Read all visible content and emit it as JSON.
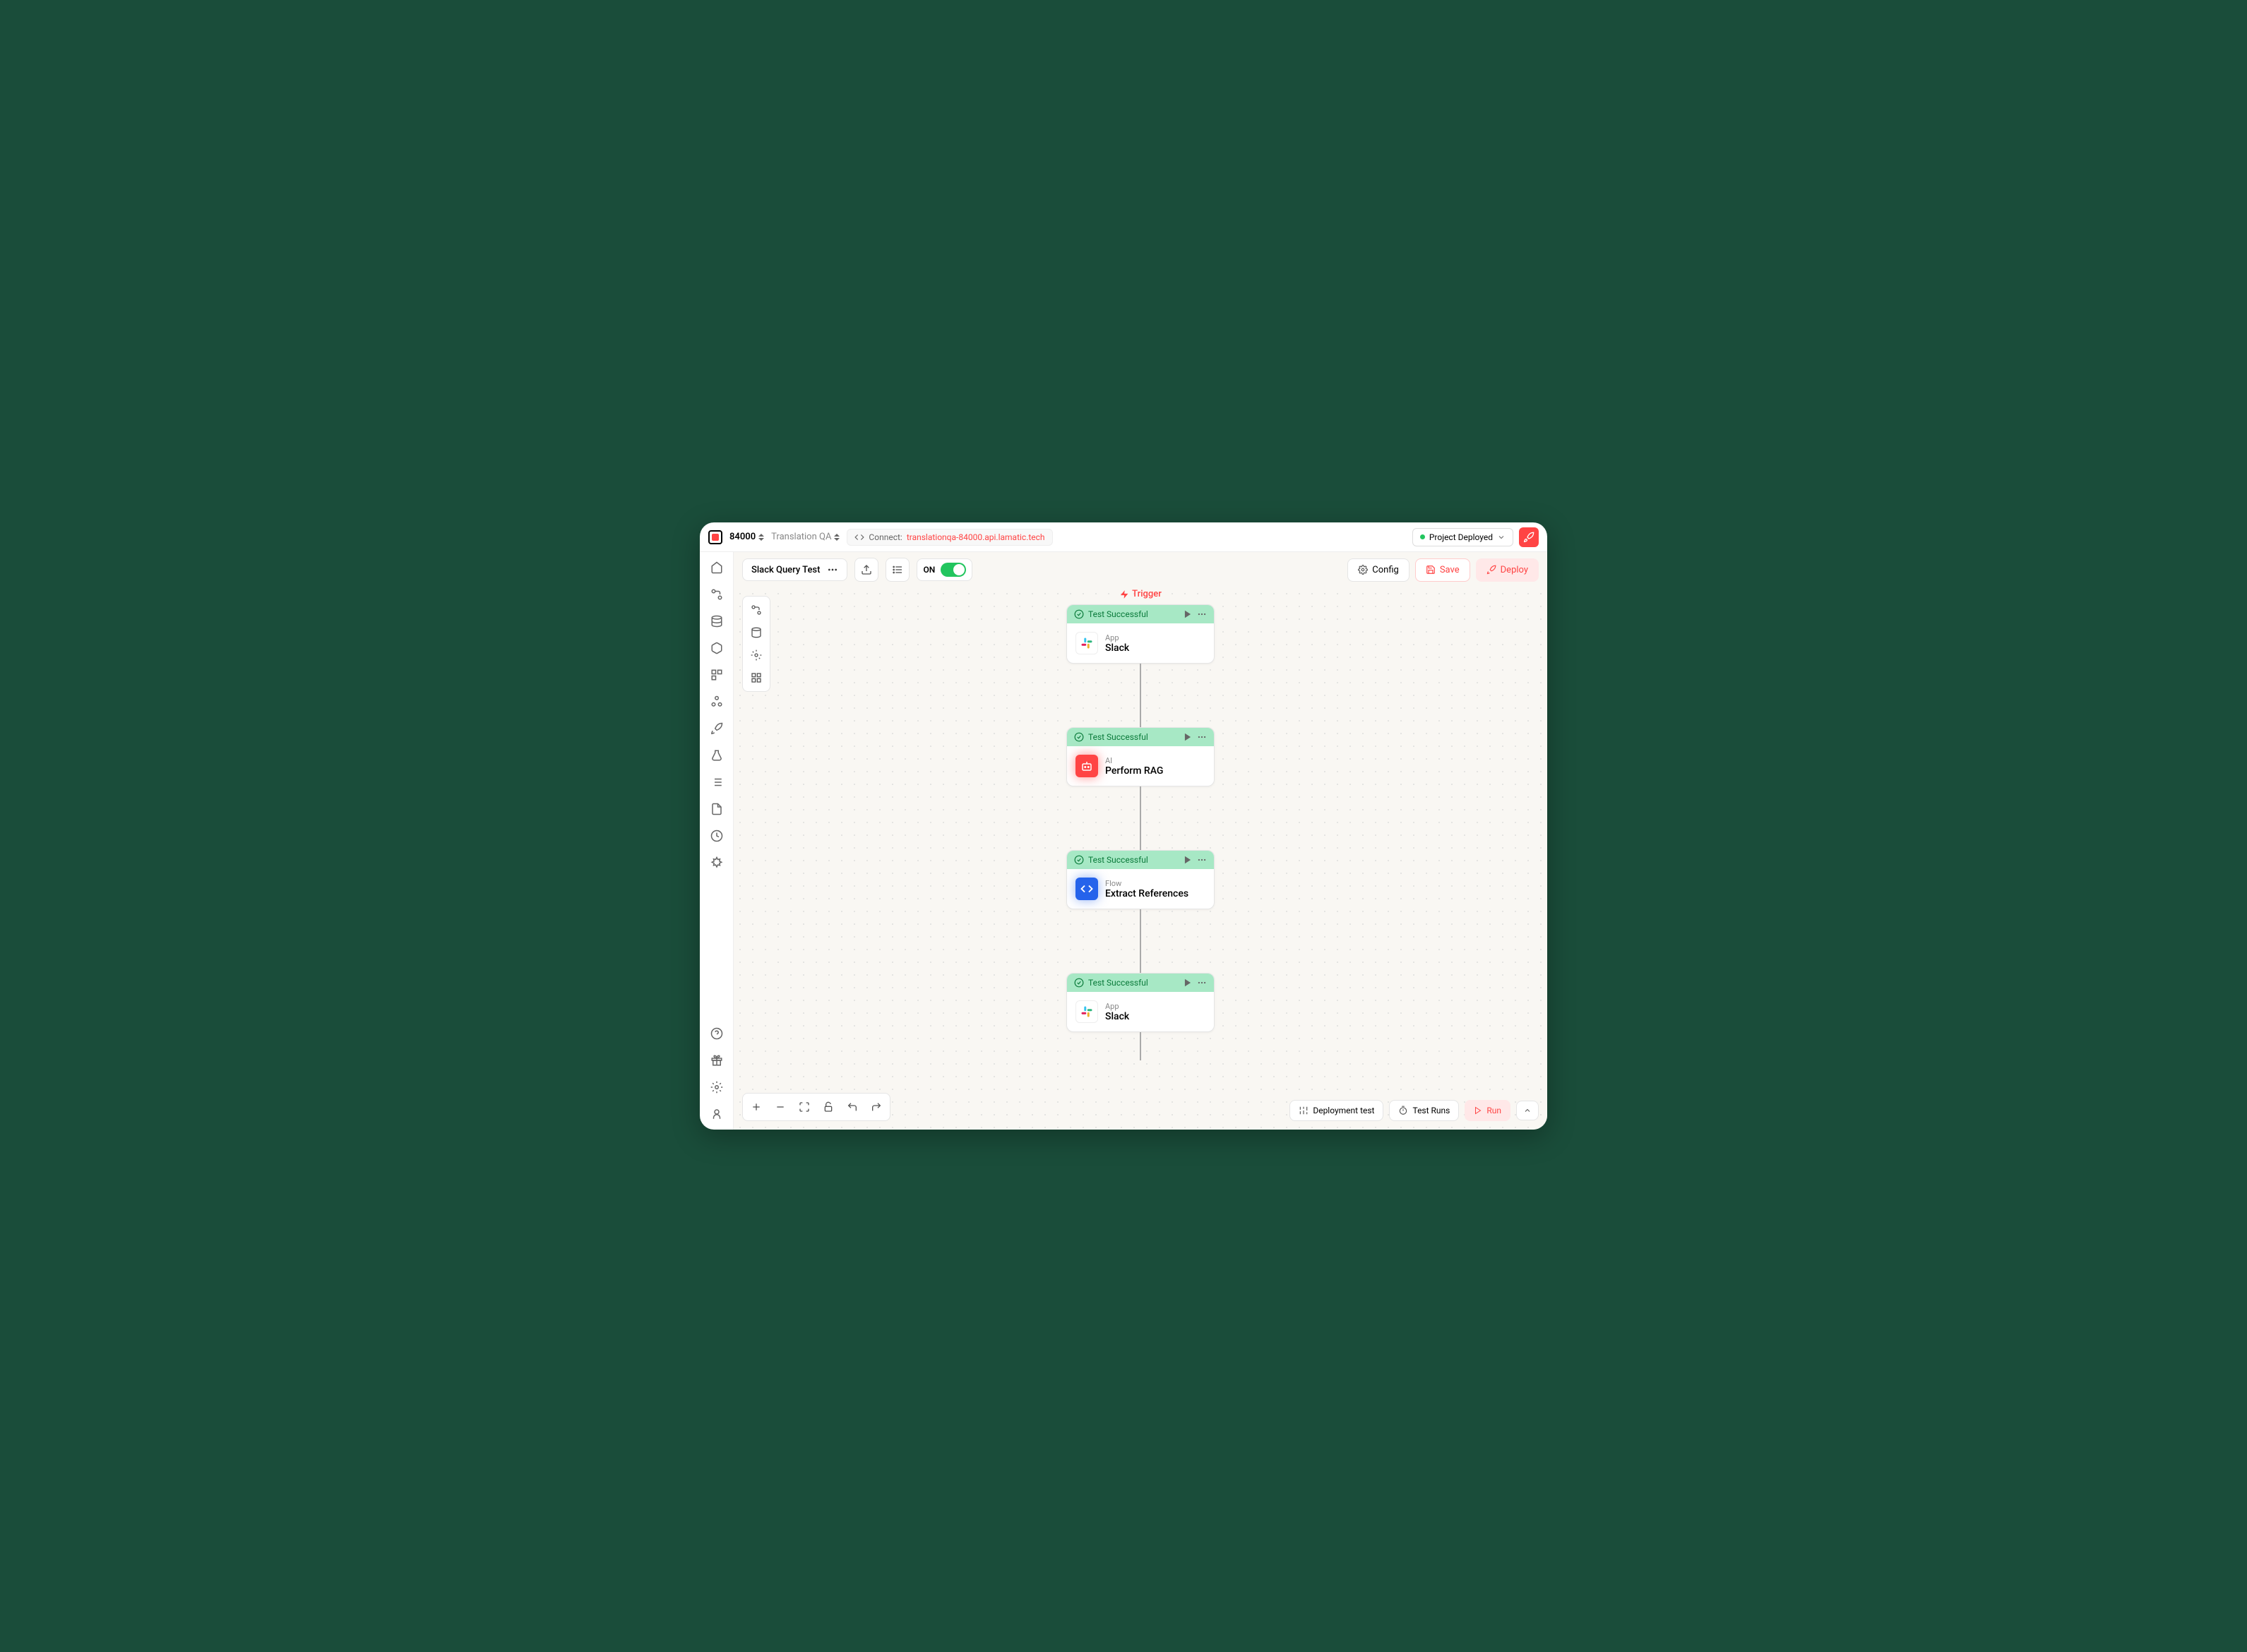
{
  "header": {
    "project_id": "84000",
    "project_name": "Translation QA",
    "connect_label": "Connect:",
    "connect_url": "translationqa-84000.api.lamatic.tech",
    "deploy_status": "Project Deployed"
  },
  "toolbar": {
    "flow_name": "Slack Query Test",
    "toggle_label": "ON",
    "config": "Config",
    "save": "Save",
    "deploy": "Deploy"
  },
  "canvas": {
    "trigger_label": "Trigger"
  },
  "nodes": [
    {
      "status": "Test Successful",
      "category": "App",
      "title": "Slack",
      "icon": "slack"
    },
    {
      "status": "Test Successful",
      "category": "AI",
      "title": "Perform RAG",
      "icon": "ai"
    },
    {
      "status": "Test Successful",
      "category": "Flow",
      "title": "Extract References",
      "icon": "flow"
    },
    {
      "status": "Test Successful",
      "category": "App",
      "title": "Slack",
      "icon": "slack"
    }
  ],
  "bottom": {
    "deployment_test": "Deployment test",
    "test_runs": "Test Runs",
    "run": "Run"
  }
}
